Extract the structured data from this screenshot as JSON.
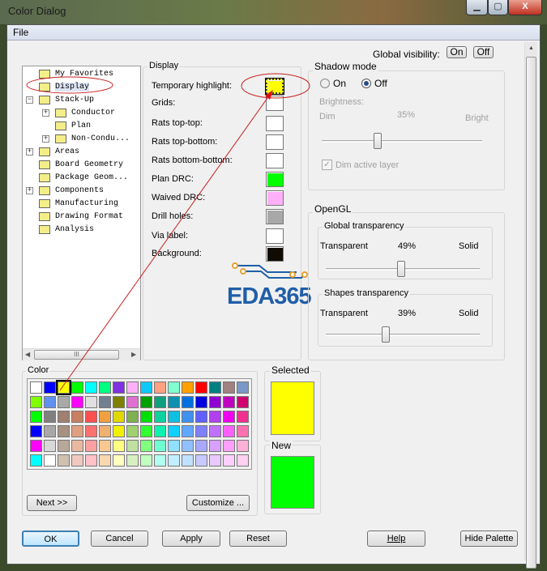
{
  "window": {
    "title": "Color Dialog",
    "min": "▁",
    "max": "▢",
    "close": "X"
  },
  "menu": {
    "file": "File"
  },
  "global_visibility": {
    "label": "Global visibility:",
    "on": "On",
    "off": "Off"
  },
  "tree": {
    "items": [
      {
        "label": "My Favorites",
        "level": 0,
        "expander": ""
      },
      {
        "label": "Display",
        "level": 0,
        "expander": ""
      },
      {
        "label": "Stack-Up",
        "level": 0,
        "expander": "−"
      },
      {
        "label": "Conductor",
        "level": 1,
        "expander": "+"
      },
      {
        "label": "Plan",
        "level": 1,
        "expander": ""
      },
      {
        "label": "Non-Condu...",
        "level": 1,
        "expander": "+"
      },
      {
        "label": "Areas",
        "level": 0,
        "expander": "+"
      },
      {
        "label": "Board Geometry",
        "level": 0,
        "expander": ""
      },
      {
        "label": "Package Geom...",
        "level": 0,
        "expander": ""
      },
      {
        "label": "Components",
        "level": 0,
        "expander": "+"
      },
      {
        "label": "Manufacturing",
        "level": 0,
        "expander": ""
      },
      {
        "label": "Drawing Format",
        "level": 0,
        "expander": ""
      },
      {
        "label": "Analysis",
        "level": 0,
        "expander": ""
      }
    ],
    "scroll_grip": "III"
  },
  "display": {
    "title": "Display",
    "rows": [
      {
        "label": "Temporary highlight:",
        "color": "#ffff00"
      },
      {
        "label": "Grids:",
        "color": "#ffffff"
      },
      {
        "label": "Rats top-top:",
        "color": "#ffffff"
      },
      {
        "label": "Rats top-bottom:",
        "color": "#ffffff"
      },
      {
        "label": "Rats bottom-bottom:",
        "color": "#ffffff"
      },
      {
        "label": "Plan DRC:",
        "color": "#00ff00"
      },
      {
        "label": "Waived DRC:",
        "color": "#ffb0f8"
      },
      {
        "label": "Drill holes:",
        "color": "#a8a8a8"
      },
      {
        "label": "Via label:",
        "color": "#ffffff"
      },
      {
        "label": "Background:",
        "color": "#100c04"
      }
    ]
  },
  "watermark": "EDA365",
  "shadow": {
    "title": "Shadow mode",
    "on": "On",
    "off": "Off",
    "selected": "Off",
    "brightness": "Brightness:",
    "dim": "Dim",
    "value": "35%",
    "bright": "Bright",
    "level": 0.35,
    "dim_active": "Dim active layer",
    "dim_checked": true
  },
  "opengl": {
    "title": "OpenGL",
    "global": {
      "title": "Global transparency",
      "left": "Transparent",
      "value": "49%",
      "right": "Solid",
      "level": 0.49
    },
    "shapes": {
      "title": "Shapes transparency",
      "left": "Transparent",
      "value": "39%",
      "right": "Solid",
      "level": 0.39
    }
  },
  "color": {
    "title": "Color",
    "palette": [
      [
        "#ffffff",
        "#0000ff",
        "#ffff00",
        "#00ff00",
        "#00ffff",
        "#00ff80",
        "#8030e0",
        "#ffb0f8",
        "#10c8f8",
        "#ffa080",
        "#80ffd0",
        "#ffa000",
        "#ff0000",
        "#008080",
        "#a08080",
        "#7898c8"
      ],
      [
        "#80ff00",
        "#6090f0",
        "#a8a8a8",
        "#ff00ff",
        "#e0e0e0",
        "#708090",
        "#808000",
        "#e070d0",
        "#00a000",
        "#10a080",
        "#1090b0",
        "#0070e0",
        "#0000e0",
        "#9000d0",
        "#c000c0",
        "#d00070"
      ],
      [
        "#00ff00",
        "#808080",
        "#a08070",
        "#c88060",
        "#ff5050",
        "#f0a040",
        "#e0d800",
        "#80b050",
        "#00e000",
        "#10d0a0",
        "#10c0e0",
        "#4090f0",
        "#6060ff",
        "#b040f0",
        "#f000f0",
        "#f03090"
      ],
      [
        "#0000ff",
        "#a8a8a8",
        "#a89080",
        "#e0a080",
        "#ff7070",
        "#f0b070",
        "#f0f000",
        "#a0d070",
        "#30ff30",
        "#10f0b0",
        "#10d0ff",
        "#60a8ff",
        "#8080ff",
        "#c070ff",
        "#ff60ff",
        "#ff70b0"
      ],
      [
        "#ff00ff",
        "#d8d8d8",
        "#b8a898",
        "#e8b8a0",
        "#ffa0a0",
        "#f8c890",
        "#ffff80",
        "#c0e0a0",
        "#80ff80",
        "#70ffd0",
        "#90e0ff",
        "#90c0ff",
        "#a8a8ff",
        "#d8a0ff",
        "#ffa0ff",
        "#ffb0d8"
      ],
      [
        "#00ffff",
        "#ffffff",
        "#d0c0b0",
        "#f0c8c0",
        "#ffc0c8",
        "#f8d8b0",
        "#ffffc0",
        "#d8f0c0",
        "#c0ffc0",
        "#b0fff0",
        "#c0f0ff",
        "#c0e0ff",
        "#c8c8ff",
        "#e8c8ff",
        "#ffd0ff",
        "#ffd0f0"
      ]
    ],
    "next": "Next >>",
    "customize": "Customize ..."
  },
  "selected": {
    "title": "Selected",
    "color": "#ffff00"
  },
  "new": {
    "title": "New",
    "color": "#00ff00"
  },
  "buttons": {
    "ok": "OK",
    "cancel": "Cancel",
    "apply": "Apply",
    "reset": "Reset",
    "help": "Help",
    "hide_palette": "Hide Palette"
  }
}
